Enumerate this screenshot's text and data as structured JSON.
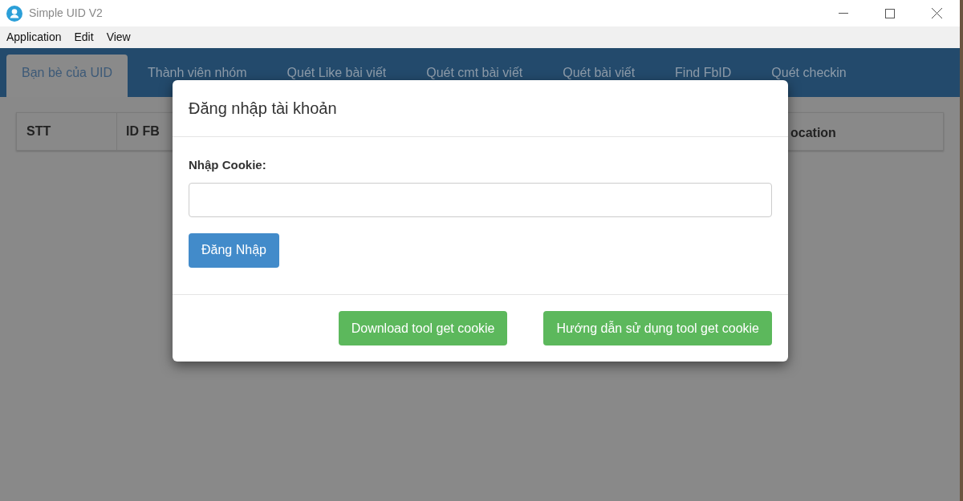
{
  "window": {
    "title": "Simple UID V2"
  },
  "menu": [
    "Application",
    "Edit",
    "View"
  ],
  "tabs": [
    {
      "label": "Bạn bè của UID",
      "selected": true
    },
    {
      "label": "Thành viên nhóm",
      "selected": false
    },
    {
      "label": "Quét Like bài viết",
      "selected": false
    },
    {
      "label": "Quét cmt bài viết",
      "selected": false
    },
    {
      "label": "Quét bài viết",
      "selected": false
    },
    {
      "label": "Find FbID",
      "selected": false
    },
    {
      "label": "Quét checkin",
      "selected": false
    }
  ],
  "table": {
    "columns": [
      "STT",
      "ID FB",
      "ocation"
    ]
  },
  "dialog": {
    "title": "Đăng nhập tài khoản",
    "cookie_label": "Nhập Cookie:",
    "login_button": "Đăng Nhập",
    "footer_buttons": [
      "Download tool get cookie",
      "Hướng dẫn sử dụng tool get cookie"
    ]
  }
}
